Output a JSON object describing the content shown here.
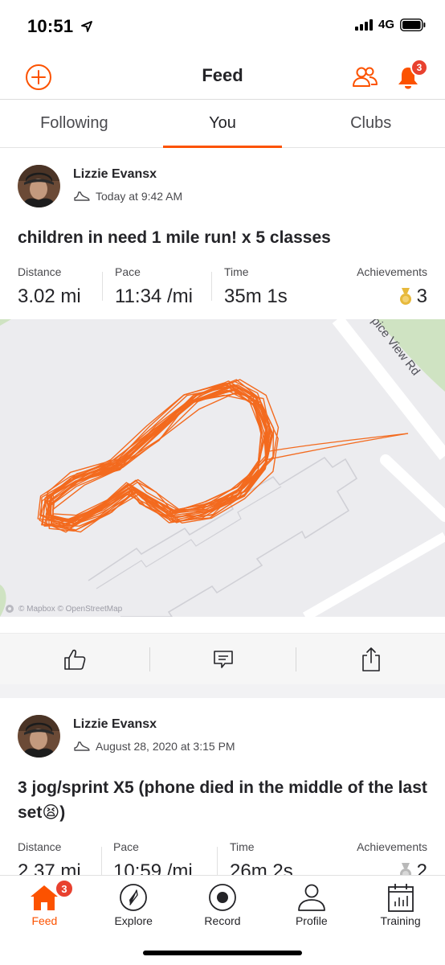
{
  "status_bar": {
    "time": "10:51",
    "network": "4G"
  },
  "header": {
    "title": "Feed",
    "notifications_count": "3"
  },
  "tabs": [
    {
      "label": "Following",
      "active": false
    },
    {
      "label": "You",
      "active": true
    },
    {
      "label": "Clubs",
      "active": false
    }
  ],
  "activities": [
    {
      "athlete": "Lizzie Evansx",
      "timestamp": "Today at 9:42 AM",
      "title": "children in need 1 mile run! x 5 classes",
      "stats": {
        "distance_label": "Distance",
        "distance": "3.02 mi",
        "pace_label": "Pace",
        "pace": "11:34 /mi",
        "time_label": "Time",
        "time": "35m 1s",
        "achievements_label": "Achievements",
        "achievements": "3"
      },
      "map": {
        "road_label": "pice View Rd",
        "attribution": "© Mapbox © OpenStreetMap"
      }
    },
    {
      "athlete": "Lizzie Evansx",
      "timestamp": "August 28, 2020 at 3:15 PM",
      "title": "3 jog/sprint X5 (phone died in the middle of the last set😫)",
      "stats": {
        "distance_label": "Distance",
        "distance": "2.37 mi",
        "pace_label": "Pace",
        "pace": "10:59 /mi",
        "time_label": "Time",
        "time": "26m 2s",
        "achievements_label": "Achievements",
        "achievements": "2"
      }
    }
  ],
  "bottom_nav": [
    {
      "label": "Feed",
      "icon": "home-icon",
      "badge": "3",
      "active": true
    },
    {
      "label": "Explore",
      "icon": "compass-icon",
      "active": false
    },
    {
      "label": "Record",
      "icon": "record-icon",
      "active": false
    },
    {
      "label": "Profile",
      "icon": "person-icon",
      "active": false
    },
    {
      "label": "Training",
      "icon": "calendar-chart-icon",
      "active": false
    }
  ],
  "colors": {
    "brand": "#fc5200",
    "badge": "#e8412f",
    "text": "#242428",
    "route": "#f36a1e",
    "medal_gold": "#e7b93c",
    "medal_silver": "#b9b9b9"
  }
}
